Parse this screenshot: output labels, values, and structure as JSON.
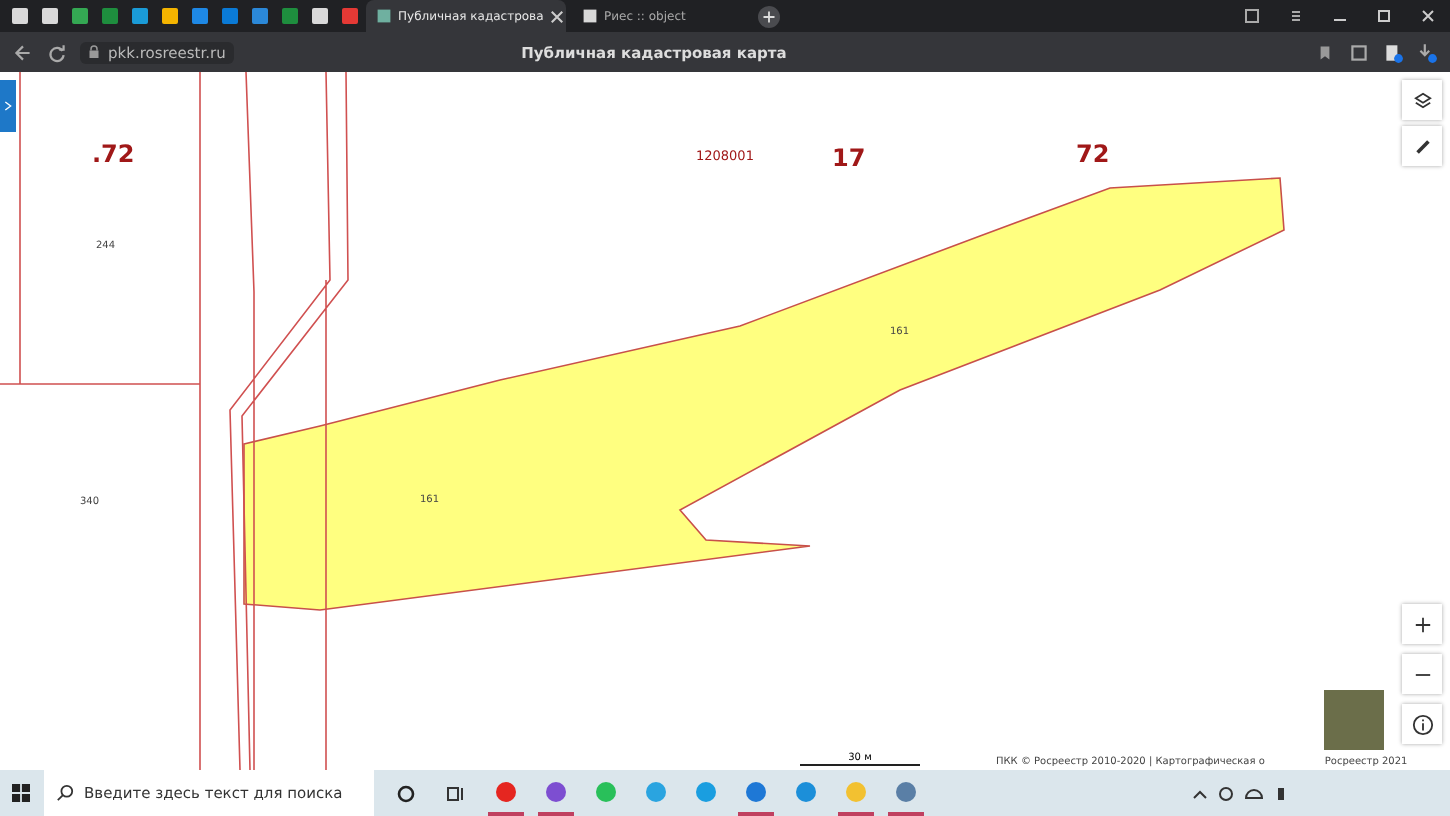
{
  "pinned_tabs": [
    {
      "color": "#d9d9d9"
    },
    {
      "color": "#d9d9d9"
    },
    {
      "color": "#34a853"
    },
    {
      "color": "#1e8e3e"
    },
    {
      "color": "#1a9bd7"
    },
    {
      "color": "#f4b400"
    },
    {
      "color": "#1e88e5"
    },
    {
      "color": "#0a7ad6"
    },
    {
      "color": "#2b88d8"
    },
    {
      "color": "#1e8e3e"
    },
    {
      "color": "#d9d9d9"
    },
    {
      "color": "#e53935"
    }
  ],
  "tabs": [
    {
      "title": "Публичная кадастрова",
      "selected": true
    },
    {
      "title": "Риес :: object",
      "selected": false
    }
  ],
  "address_bar": {
    "url": "pkk.rosreestr.ru",
    "page_title": "Публичная кадастровая карта"
  },
  "map": {
    "labels": [
      {
        "text": ".72",
        "kind": "block"
      },
      {
        "text": "244",
        "kind": "parcel"
      },
      {
        "text": "340",
        "kind": "parcel"
      },
      {
        "text": "1208001",
        "kind": "quarter"
      },
      {
        "text": "17",
        "kind": "block"
      },
      {
        "text": "72",
        "kind": "block"
      },
      {
        "text": "161",
        "kind": "parcel"
      },
      {
        "text": "161",
        "kind": "parcel"
      }
    ],
    "scale": "30 м",
    "attribution": [
      "ПКК © Росреестр 2010-2020 | Картографическая о",
      "Росреестр 2021"
    ]
  },
  "taskbar": {
    "search_placeholder": "Введите здесь текст для поиска",
    "apps": [
      {
        "kind": "yandex",
        "running": true
      },
      {
        "kind": "viber",
        "running": true
      },
      {
        "kind": "whatsapp",
        "running": false
      },
      {
        "kind": "telegram",
        "running": false
      },
      {
        "kind": "skype",
        "running": false
      },
      {
        "kind": "mail",
        "running": true
      },
      {
        "kind": "edge",
        "running": false
      },
      {
        "kind": "files",
        "running": true
      },
      {
        "kind": "calculator",
        "running": true
      }
    ]
  }
}
